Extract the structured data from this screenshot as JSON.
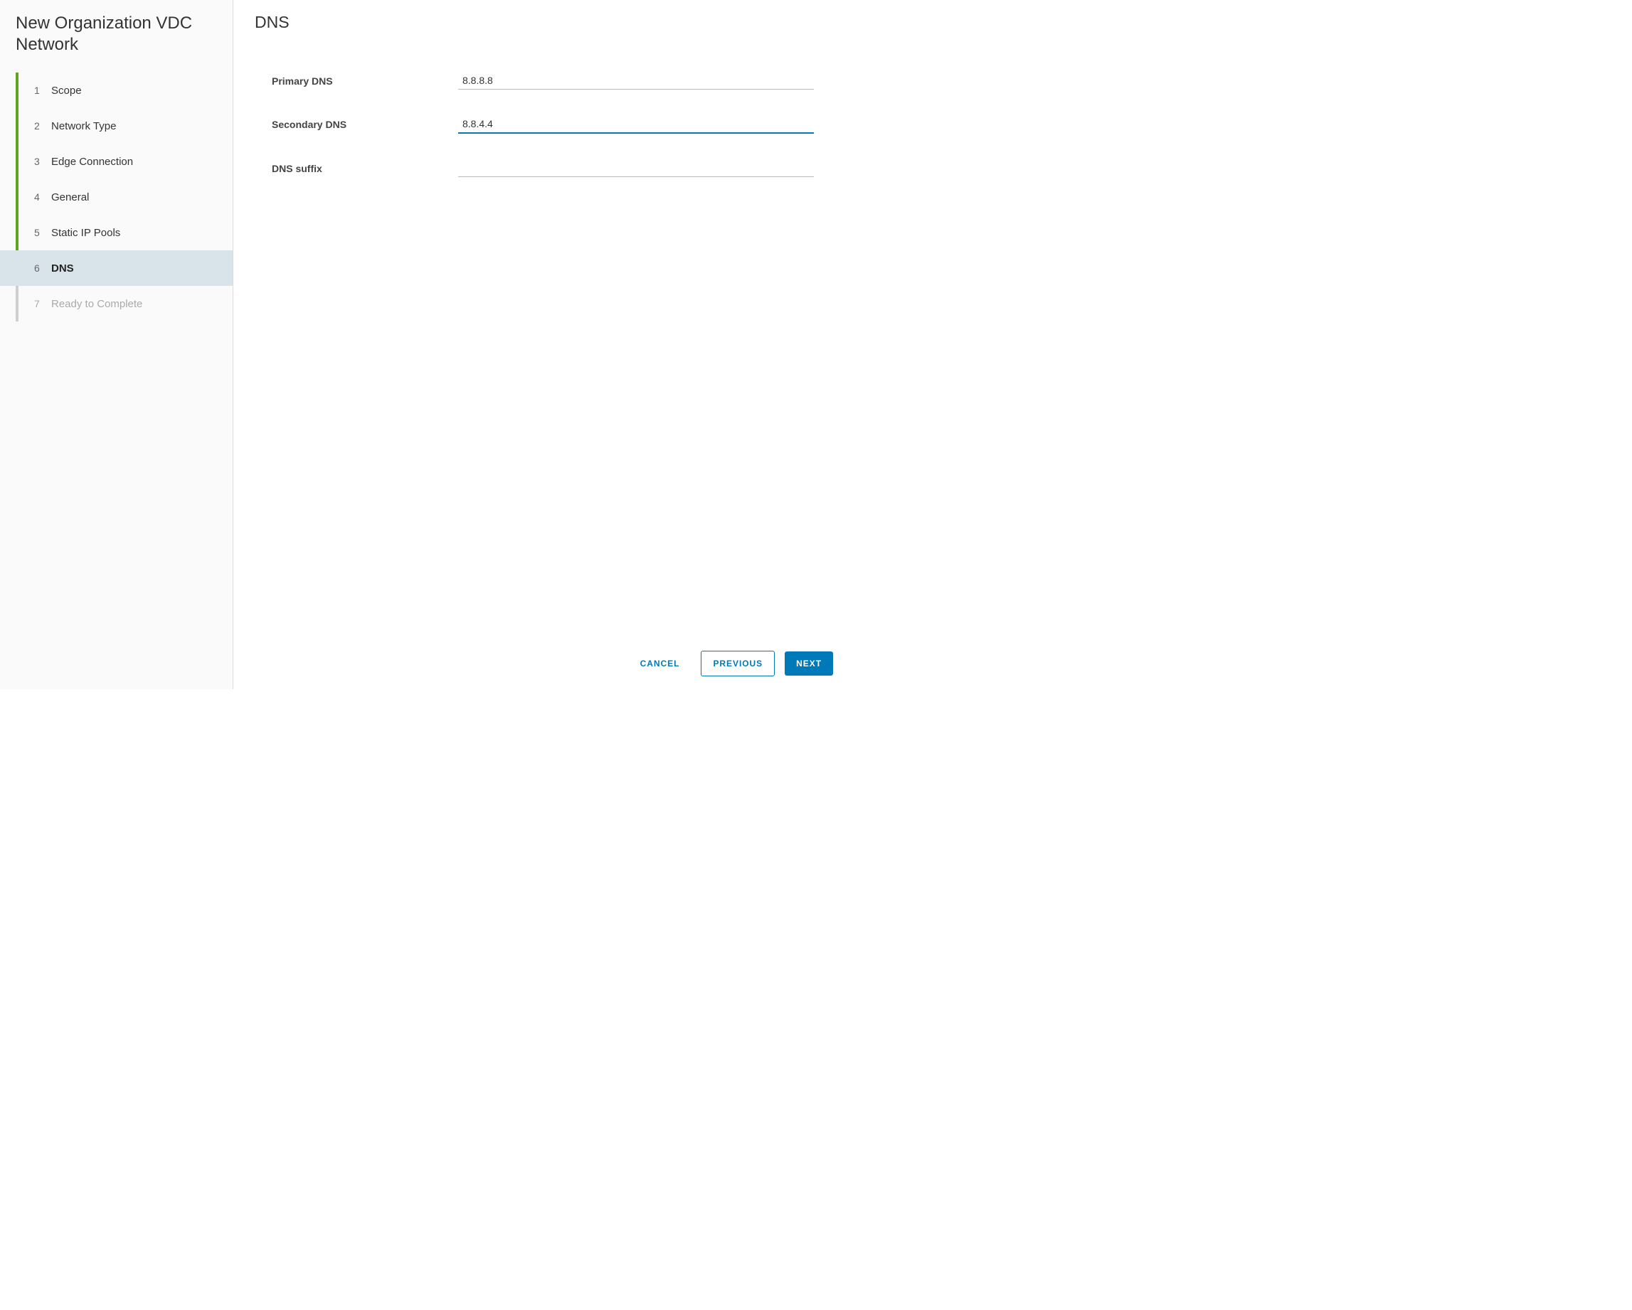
{
  "sidebar": {
    "title": "New Organization VDC Network",
    "steps": [
      {
        "number": "1",
        "label": "Scope",
        "state": "completed"
      },
      {
        "number": "2",
        "label": "Network Type",
        "state": "completed"
      },
      {
        "number": "3",
        "label": "Edge Connection",
        "state": "completed"
      },
      {
        "number": "4",
        "label": "General",
        "state": "completed"
      },
      {
        "number": "5",
        "label": "Static IP Pools",
        "state": "completed"
      },
      {
        "number": "6",
        "label": "DNS",
        "state": "active"
      },
      {
        "number": "7",
        "label": "Ready to Complete",
        "state": "disabled"
      }
    ]
  },
  "main": {
    "title": "DNS",
    "fields": {
      "primary_dns": {
        "label": "Primary DNS",
        "value": "8.8.8.8"
      },
      "secondary_dns": {
        "label": "Secondary DNS",
        "value": "8.8.4.4"
      },
      "dns_suffix": {
        "label": "DNS suffix",
        "value": ""
      }
    }
  },
  "footer": {
    "cancel": "CANCEL",
    "previous": "PREVIOUS",
    "next": "NEXT"
  }
}
